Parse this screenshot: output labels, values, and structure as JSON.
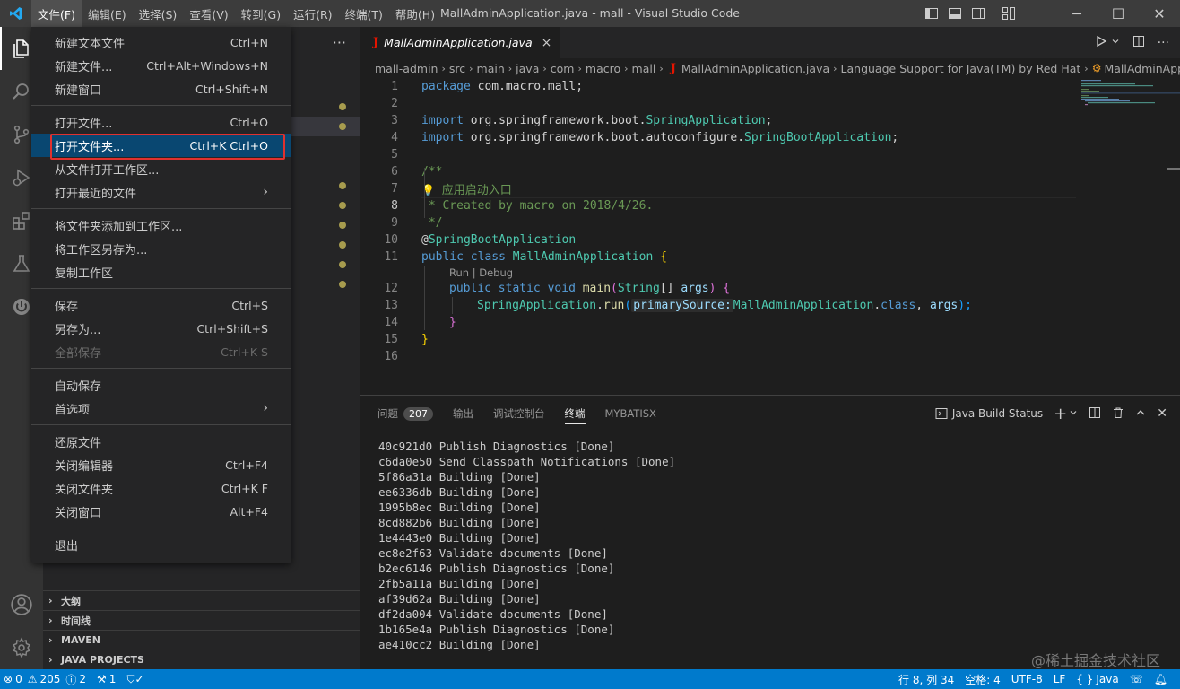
{
  "window": {
    "title": "MallAdminApplication.java - mall - Visual Studio Code",
    "minimize": "─",
    "maximize": "☐",
    "close": "✕"
  },
  "menubar": [
    "文件(F)",
    "编辑(E)",
    "选择(S)",
    "查看(V)",
    "转到(G)",
    "运行(R)",
    "终端(T)",
    "帮助(H)"
  ],
  "file_menu": {
    "items": [
      {
        "label": "新建文本文件",
        "key": "Ctrl+N"
      },
      {
        "label": "新建文件...",
        "key": "Ctrl+Alt+Windows+N"
      },
      {
        "label": "新建窗口",
        "key": "Ctrl+Shift+N"
      },
      {
        "label": "打开文件...",
        "key": "Ctrl+O"
      },
      {
        "label": "打开文件夹...",
        "key": "Ctrl+K Ctrl+O"
      },
      {
        "label": "从文件打开工作区...",
        "key": ""
      },
      {
        "label": "打开最近的文件",
        "key": "›"
      },
      {
        "label": "将文件夹添加到工作区...",
        "key": ""
      },
      {
        "label": "将工作区另存为...",
        "key": ""
      },
      {
        "label": "复制工作区",
        "key": ""
      },
      {
        "label": "保存",
        "key": "Ctrl+S"
      },
      {
        "label": "另存为...",
        "key": "Ctrl+Shift+S"
      },
      {
        "label": "全部保存",
        "key": "Ctrl+K S"
      },
      {
        "label": "自动保存",
        "key": ""
      },
      {
        "label": "首选项",
        "key": "›"
      },
      {
        "label": "还原文件",
        "key": ""
      },
      {
        "label": "关闭编辑器",
        "key": "Ctrl+F4"
      },
      {
        "label": "关闭文件夹",
        "key": "Ctrl+K F"
      },
      {
        "label": "关闭窗口",
        "key": "Alt+F4"
      },
      {
        "label": "退出",
        "key": ""
      }
    ]
  },
  "sidebar": {
    "more": "···",
    "sections": [
      "大纲",
      "时间线",
      "MAVEN",
      "JAVA PROJECTS"
    ]
  },
  "editor": {
    "tab": {
      "icon": "J",
      "label": "MallAdminApplication.java",
      "close": "×"
    },
    "breadcrumb": [
      "mall-admin",
      "src",
      "main",
      "java",
      "com",
      "macro",
      "mall",
      "MallAdminApplication.java",
      "Language Support for Java(TM) by Red Hat",
      "MallAdminApplic"
    ],
    "line_numbers": [
      "1",
      "2",
      "3",
      "4",
      "5",
      "6",
      "7",
      "8",
      "9",
      "10",
      "11",
      "12",
      "13",
      "14",
      "15",
      "16"
    ],
    "codelens": "Run | Debug",
    "code": {
      "l1_kw": "package",
      "l1_rest": " com.macro.mall;",
      "l3_kw": "import",
      "l3_pkg": " org.springframework.boot.",
      "l3_cls": "SpringApplication",
      "l3_end": ";",
      "l4_kw": "import",
      "l4_pkg": " org.springframework.boot.autoconfigure.",
      "l4_cls": "SpringBootApplication",
      "l4_end": ";",
      "l6": "/**",
      "l7_bulb": "💡",
      "l7_text": "应用启动入口",
      "l8": " * Created by macro on 2018/4/26.",
      "l9": " */",
      "l10_at": "@",
      "l10_ann": "SpringBootApplication",
      "l11_kw1": "public",
      "l11_kw2": "class",
      "l11_cls": "MallAdminApplication",
      "l11_br": "{",
      "l12_kw1": "public",
      "l12_kw2": "static",
      "l12_kw3": "void",
      "l12_fn": "main",
      "l12_p1": "(",
      "l12_ty": "String",
      "l12_arr": "[] ",
      "l12_var": "args",
      "l12_p2": ")",
      "l12_br": "{",
      "l13_cls": "SpringApplication",
      "l13_dot": ".",
      "l13_fn": "run",
      "l13_p1": "(",
      "l13_hint": "primarySource:",
      "l13_cls2": "MallAdminApplication",
      "l13_dot2": ".",
      "l13_kw": "class",
      "l13_comma": ", ",
      "l13_var": "args",
      "l13_p2": ");",
      "l14_br": "}",
      "l15_br": "}"
    }
  },
  "panel": {
    "tabs": [
      "问题",
      "输出",
      "调试控制台",
      "终端",
      "MYBATISX"
    ],
    "problems_count": "207",
    "java_build_status": "Java Build Status",
    "terminal_lines": [
      "40c921d0 Publish Diagnostics [Done]",
      "c6da0e50 Send Classpath Notifications [Done]",
      "5f86a31a Building [Done]",
      "ee6336db Building [Done]",
      "1995b8ec Building [Done]",
      "8cd882b6 Building [Done]",
      "1e4443e0 Building [Done]",
      "ec8e2f63 Validate documents [Done]",
      "b2ec6146 Publish Diagnostics [Done]",
      "2fb5a11a Building [Done]",
      "af39d62a Building [Done]",
      "df2da004 Validate documents [Done]",
      "1b165e4a Publish Diagnostics [Done]",
      "ae410cc2 Building [Done]"
    ]
  },
  "statusbar": {
    "errors": "0",
    "warnings": "205",
    "info": "2",
    "tools": "1",
    "position": "行 8, 列 34",
    "spaces": "空格: 4",
    "encoding": "UTF-8",
    "eol": "LF",
    "language": "Java"
  },
  "watermark": "@稀土掘金技术社区",
  "colors": {
    "statusbar": "#007acc",
    "menu_highlight": "#094771",
    "red_box": "#e0312e"
  }
}
